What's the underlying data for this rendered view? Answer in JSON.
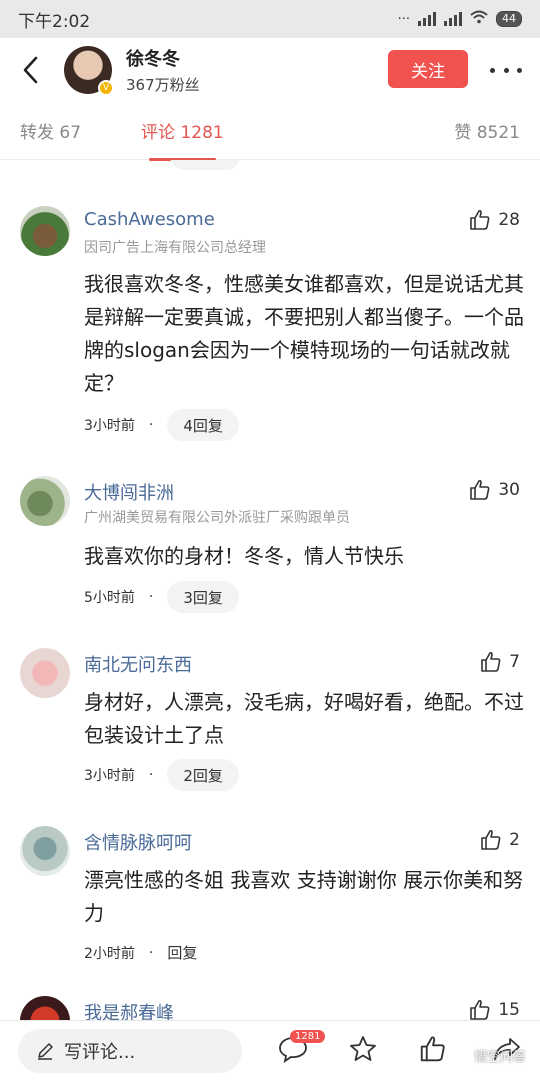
{
  "status_bar": {
    "time": "下午2:02",
    "battery": "44"
  },
  "header": {
    "user_name": "徐冬冬",
    "fans": "367万粉丝",
    "follow_label": "关注"
  },
  "tabs": {
    "repost": "转发 67",
    "comments": "评论 1281",
    "likes": "赞 8521"
  },
  "comments": [
    {
      "name": "CashAwesome",
      "sub": "因司广告上海有限公司总经理",
      "likes": "28",
      "text": "我很喜欢冬冬，性感美女谁都喜欢，但是说话尤其是辩解一定要真诚，不要把别人都当傻子。一个品牌的slogan会因为一个模特现场的一句话就改就定？",
      "time": "3小时前",
      "replies": "4回复"
    },
    {
      "name": "大博闯非洲",
      "sub": "广州湖美贸易有限公司外派驻厂采购跟单员",
      "likes": "30",
      "text": "我喜欢你的身材！冬冬，情人节快乐",
      "time": "5小时前",
      "replies": "3回复"
    },
    {
      "name": "南北无问东西",
      "sub": "",
      "likes": "7",
      "text": "身材好，人漂亮，没毛病，好喝好看，绝配。不过包装设计土了点",
      "time": "3小时前",
      "replies": "2回复"
    },
    {
      "name": "含情脉脉呵呵",
      "sub": "",
      "likes": "2",
      "text": "漂亮性感的冬姐 我喜欢 支持谢谢你 展示你美和努力",
      "time": "2小时前",
      "replies": "回复"
    },
    {
      "name": "我是郝春峰",
      "likes": "15"
    }
  ],
  "bottom_bar": {
    "placeholder": "写评论...",
    "comment_count": "1281"
  },
  "watermark": "悟空问答",
  "colors": {
    "accent": "#f0534f",
    "link": "#4a6a97"
  }
}
